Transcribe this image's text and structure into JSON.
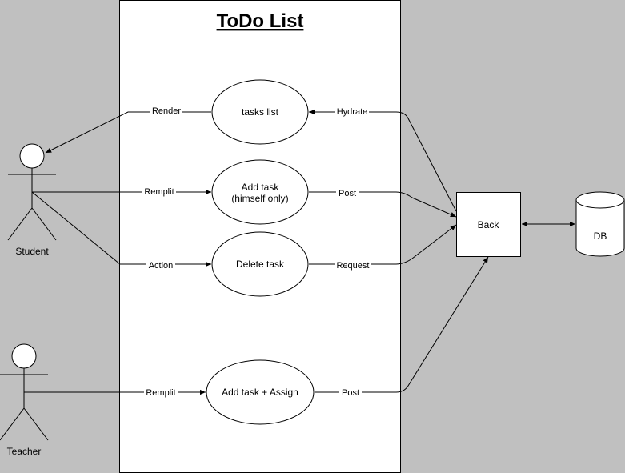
{
  "diagram": {
    "title": "ToDo List",
    "actors": {
      "student": "Student",
      "teacher": "Teacher"
    },
    "use_cases": {
      "tasks_list": "tasks list",
      "add_task_line1": "Add task",
      "add_task_line2": "(himself only)",
      "delete_task": "Delete task",
      "add_task_assign": "Add task + Assign"
    },
    "nodes": {
      "back": "Back",
      "db": "DB"
    },
    "edge_labels": {
      "render": "Render",
      "remplit_student": "Remplit",
      "action": "Action",
      "remplit_teacher": "Remplit",
      "hydrate": "Hydrate",
      "post_add": "Post",
      "request_delete": "Request",
      "post_assign": "Post"
    },
    "colors": {
      "background": "#c0c0c0",
      "system_box": "#ffffff",
      "stroke": "#000000"
    }
  }
}
